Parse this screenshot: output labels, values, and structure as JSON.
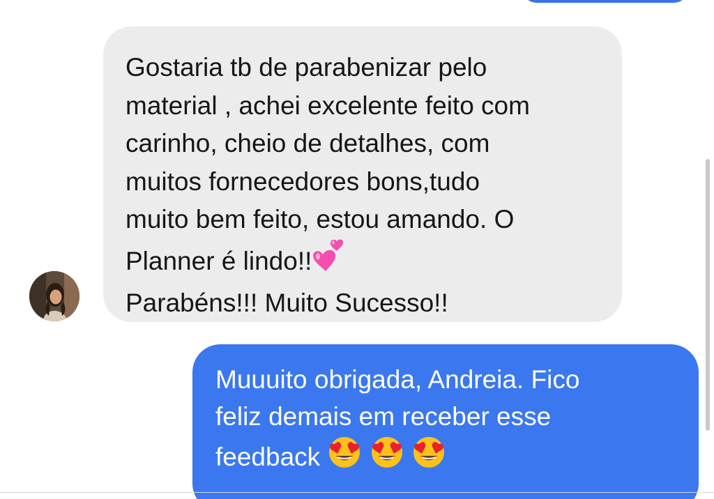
{
  "conversation": {
    "incoming_message": {
      "lines": [
        "Gostaria tb de parabenizar pelo",
        "material , achei excelente feito com",
        "carinho, cheio de detalhes, com",
        "muitos fornecedores bons,tudo",
        "muito bem feito, estou amando. O",
        "Planner é lindo!!",
        "Parabéns!!! Muito Sucesso!!"
      ],
      "emoji_icon": "two-hearts-icon"
    },
    "outgoing_message": {
      "lines": [
        "Muuuito obrigada, Andreia. Fico",
        "feliz demais em receber esse",
        "feedback"
      ],
      "emoji_icon": "heart-eyes-icon"
    },
    "avatar_icon": "avatar"
  },
  "colors": {
    "incoming_bubble": "#ececec",
    "outgoing_bubble": "#3b78f0",
    "incoming_text": "#161616",
    "outgoing_text": "#ffffff"
  }
}
